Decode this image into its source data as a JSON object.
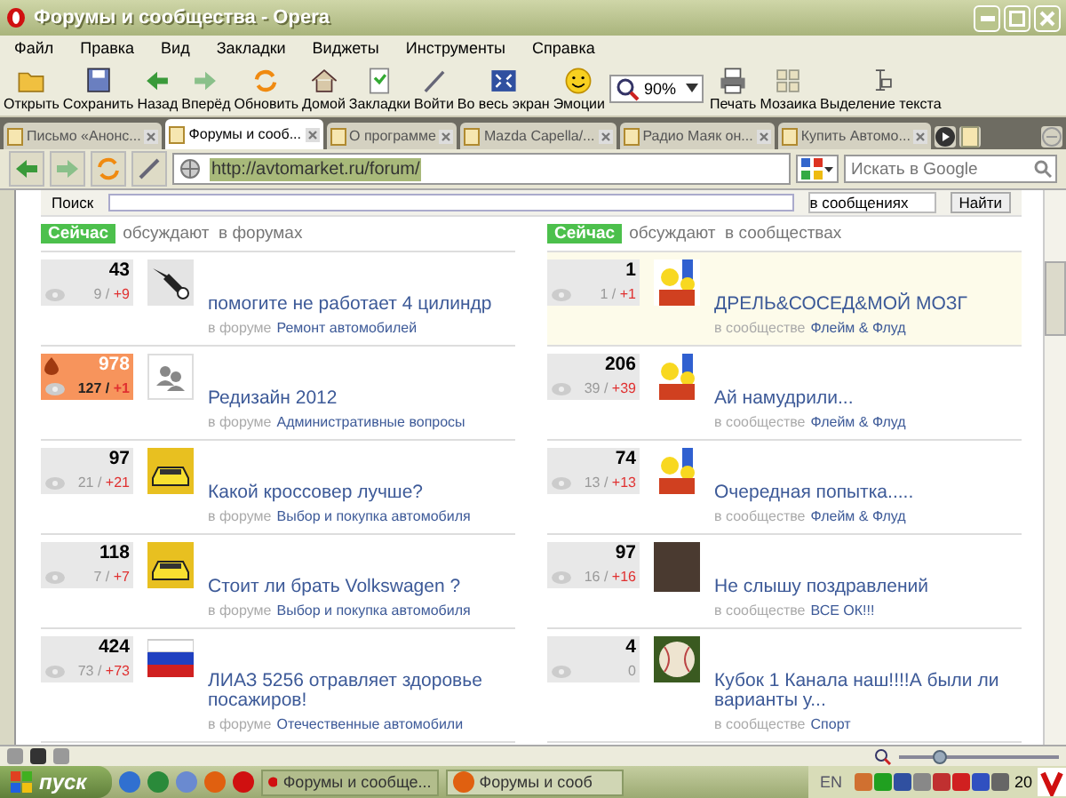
{
  "window": {
    "title": "Форумы и сообщества - Opera"
  },
  "menu": [
    "Файл",
    "Правка",
    "Вид",
    "Закладки",
    "Виджеты",
    "Инструменты",
    "Справка"
  ],
  "toolbar": [
    {
      "label": "Открыть"
    },
    {
      "label": "Сохранить"
    },
    {
      "label": "Назад"
    },
    {
      "label": "Вперёд"
    },
    {
      "label": "Обновить"
    },
    {
      "label": "Домой"
    },
    {
      "label": "Закладки"
    },
    {
      "label": "Войти"
    },
    {
      "label": "Во весь экран"
    },
    {
      "label": "Эмоции"
    },
    {
      "label": "90%",
      "kind": "zoom"
    },
    {
      "label": "Печать"
    },
    {
      "label": "Мозаика"
    },
    {
      "label": "Выделение текста"
    }
  ],
  "tabs": [
    {
      "label": "Письмо «Анонс...",
      "selected": false
    },
    {
      "label": "Форумы и сооб...",
      "selected": true
    },
    {
      "label": "О программе",
      "selected": false
    },
    {
      "label": "Mazda Capella/...",
      "selected": false
    },
    {
      "label": "Радио Маяк он...",
      "selected": false
    },
    {
      "label": "Купить Автомо...",
      "selected": false
    }
  ],
  "address": {
    "url": "http://avtomarket.ru/forum/",
    "search_placeholder": "Искать в Google"
  },
  "site_search": {
    "label": "Поиск",
    "scope": "в сообщениях",
    "button": "Найти"
  },
  "columns": [
    {
      "badge": "Сейчас",
      "heading": "обсуждают  в форумах",
      "topics": [
        {
          "count": "43",
          "views": "9",
          "sep": "/",
          "plus": "+9",
          "hot": false,
          "highlighted": false,
          "title": "помогите не работает 4 цилиндр",
          "prefix": "в форуме",
          "place": "Ремонт автомобилей"
        },
        {
          "count": "978",
          "views": "127",
          "sep": "/",
          "plus": "+1",
          "hot": true,
          "highlighted": false,
          "title": "Редизайн 2012",
          "prefix": "в форуме",
          "place": "Административные вопросы"
        },
        {
          "count": "97",
          "views": "21",
          "sep": "/",
          "plus": "+21",
          "hot": false,
          "highlighted": false,
          "title": "Какой кроссовер лучше?",
          "prefix": "в форуме",
          "place": "Выбор и покупка автомобиля"
        },
        {
          "count": "118",
          "views": "7",
          "sep": "/",
          "plus": "+7",
          "hot": false,
          "highlighted": false,
          "title": "Стоит ли брать Volkswagen ?",
          "prefix": "в форуме",
          "place": "Выбор и покупка автомобиля"
        },
        {
          "count": "424",
          "views": "73",
          "sep": "/",
          "plus": "+73",
          "hot": false,
          "highlighted": false,
          "title": "ЛИАЗ 5256 отравляет здоровье посажиров!",
          "prefix": "в форуме",
          "place": "Отечественные автомобили"
        }
      ]
    },
    {
      "badge": "Сейчас",
      "heading": "обсуждают  в сообществах",
      "topics": [
        {
          "count": "1",
          "views": "1",
          "sep": "/",
          "plus": "+1",
          "hot": false,
          "highlighted": true,
          "title": "ДРЕЛЬ&СОСЕД&МОЙ МОЗГ",
          "prefix": "в сообществе",
          "place": "Флейм & Флуд"
        },
        {
          "count": "206",
          "views": "39",
          "sep": "/",
          "plus": "+39",
          "hot": false,
          "highlighted": false,
          "title": "Ай намудрили...",
          "prefix": "в сообществе",
          "place": "Флейм & Флуд"
        },
        {
          "count": "74",
          "views": "13",
          "sep": "/",
          "plus": "+13",
          "hot": false,
          "highlighted": false,
          "title": "Очередная попытка.....",
          "prefix": "в сообществе",
          "place": "Флейм & Флуд"
        },
        {
          "count": "97",
          "views": "16",
          "sep": "/",
          "plus": "+16",
          "hot": false,
          "highlighted": false,
          "title": "Не слышу поздравлений",
          "prefix": "в сообществе",
          "place": "ВСЕ ОК!!!"
        },
        {
          "count": "4",
          "views": "0",
          "hot": false,
          "highlighted": false,
          "title": "Кубок 1 Канала наш!!!!А были ли варианты у...",
          "prefix": "в сообществе",
          "place": "Спорт"
        }
      ]
    }
  ],
  "zoom_slider": {
    "level": 0.25
  },
  "taskbar": {
    "start": "пуск",
    "tasks": [
      {
        "label": "Форумы и сообще...",
        "selected": true
      },
      {
        "label": "Форумы и сооб",
        "selected": false
      }
    ],
    "lang": "EN",
    "clock": "20"
  }
}
